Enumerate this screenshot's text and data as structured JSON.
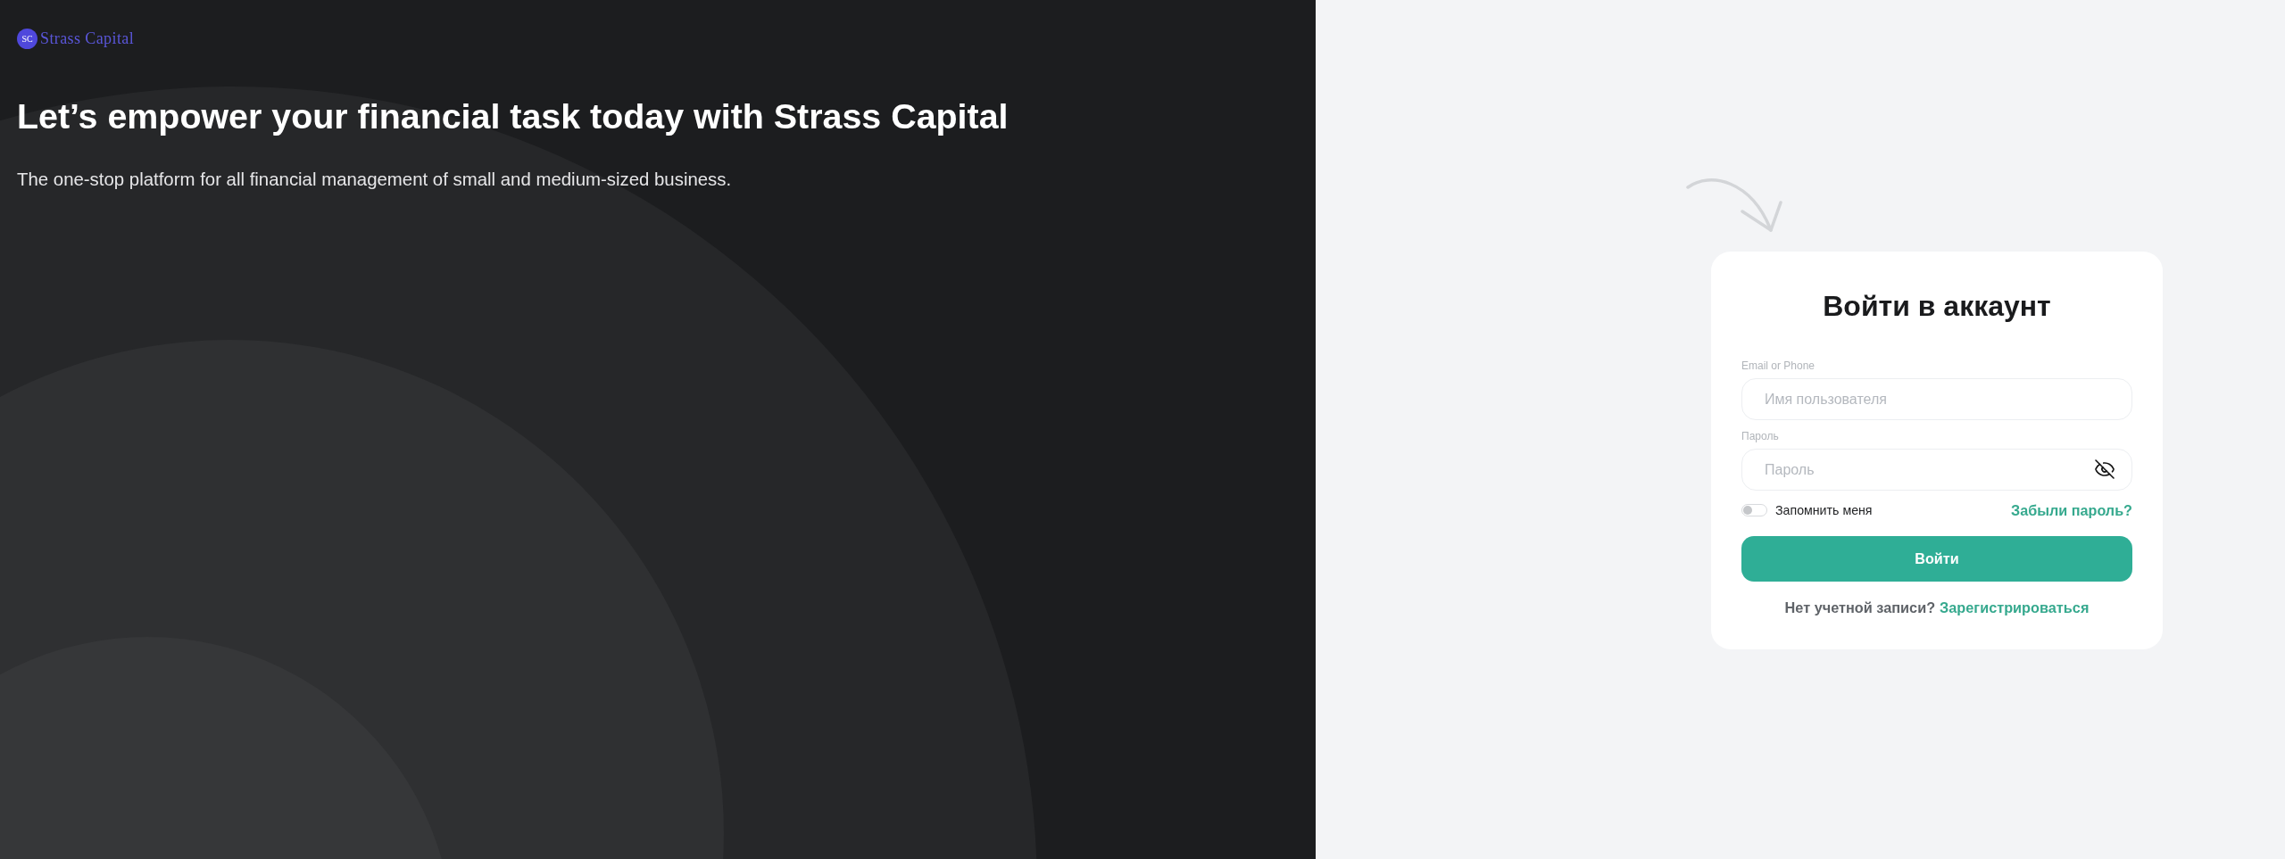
{
  "brand": {
    "mark": "SC",
    "name": "Strass Capital"
  },
  "hero": {
    "title": "Let’s empower your financial task today with Strass Capital",
    "subtitle": "The one-stop platform for all financial management of small and medium-sized business."
  },
  "login": {
    "title": "Войти в аккаунт",
    "fields": [
      {
        "kind": "text",
        "label": "Email or Phone",
        "placeholder": "Имя пользователя"
      },
      {
        "kind": "password",
        "label": "Пароль",
        "placeholder": "Пароль",
        "revealed": false
      }
    ],
    "remember": {
      "label": "Запомнить меня",
      "on": false
    },
    "forgot_link": "Забыли пароль?",
    "submit": "Войти",
    "signup": {
      "prompt": "Нет учетной записи?",
      "link": "Зарегистрироваться"
    }
  }
}
